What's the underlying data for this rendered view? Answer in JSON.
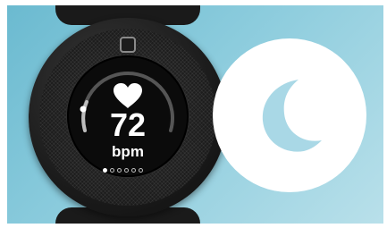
{
  "watch": {
    "heart_rate": "72",
    "unit": "bpm",
    "page_dots_total": 6,
    "page_dots_active_index": 0,
    "heart_icon": "heart-icon"
  },
  "badge": {
    "icon": "moon-icon"
  },
  "colors": {
    "background": "#8cccdd",
    "watch_body": "#1b1b1b",
    "text": "#ffffff",
    "moon": "#a9d8e6"
  }
}
